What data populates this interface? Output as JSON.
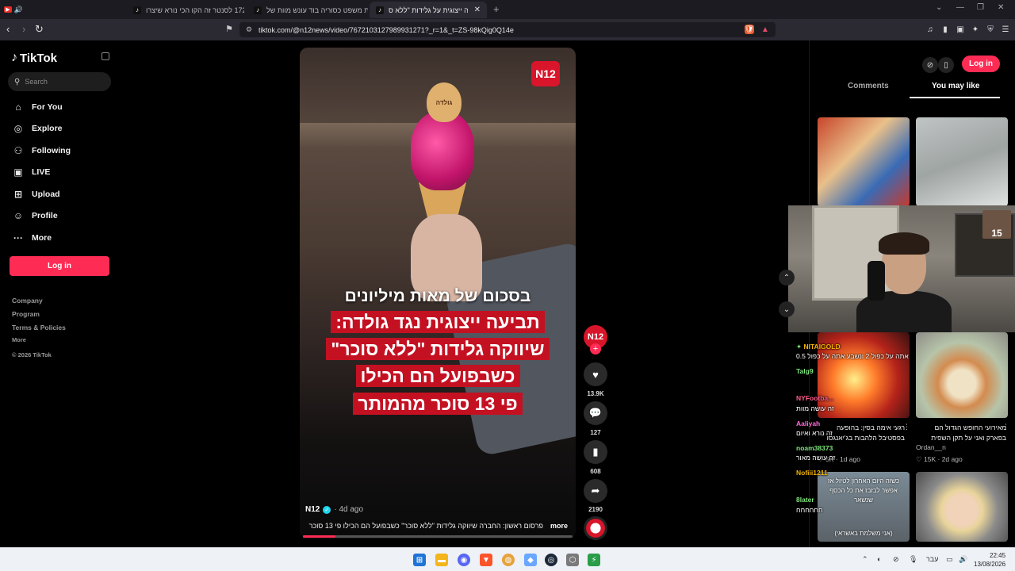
{
  "browser": {
    "tabs": [
      {
        "title": "קו 172 לסנטר זה הקו הכי נורא שיצרו",
        "active": false
      },
      {
        "title": "בית משפט כסוריה בוד עונש מוות של...",
        "active": false
      },
      {
        "title": "תביעה ייצוגית על גלידות \"ללא ס...",
        "active": true
      }
    ],
    "new_tab": "+",
    "url": "tiktok.com/@n12news/video/7672103127989931271?_r=1&_t=ZS-98kQig0Q14e"
  },
  "sidebar": {
    "logo": "TikTok",
    "search_placeholder": "Search",
    "menu": [
      {
        "label": "For You",
        "icon": "home-icon"
      },
      {
        "label": "Explore",
        "icon": "compass-icon"
      },
      {
        "label": "Following",
        "icon": "following-icon"
      },
      {
        "label": "LIVE",
        "icon": "live-icon"
      },
      {
        "label": "Upload",
        "icon": "upload-icon"
      },
      {
        "label": "Profile",
        "icon": "profile-icon"
      },
      {
        "label": "More",
        "icon": "more-icon"
      }
    ],
    "login": "Log in",
    "footer": [
      "Company",
      "Program",
      "Terms & Policies",
      "More"
    ],
    "copyright": "© 2026 TikTok"
  },
  "video": {
    "badge": "N12",
    "cookie_text": "גולדה",
    "headline_top": "בסכום של מאות מיליונים",
    "headline_lines": [
      "תביעה ייצוגית נגד גולדה:",
      "שיווקה גלידות \"ללא סוכר\"",
      "כשבפועל הם הכילו",
      "פי 13 סוכר מהמותר"
    ],
    "author": "N12",
    "posted": "· 4d ago",
    "caption": "פרסום ראשון: החברה שיווקה גלידות \"ללא סוכר\" כשבפועל הם הכילו פי 13 סוכר",
    "more": "more",
    "progress": 0.12
  },
  "actions": {
    "avatar": "N12",
    "likes": "13.9K",
    "comments": "127",
    "saves": "608",
    "shares": "2190"
  },
  "right_panel": {
    "login": "Log in",
    "tabs": [
      "Comments",
      "You may like"
    ],
    "active_tab": "You may like",
    "cards": [
      {
        "title": "רגעי אימה בסין: בהופעה בפסטיבל הלהבות בג'יאנגסו",
        "author": "",
        "likes": "5K",
        "age": "1d ago"
      },
      {
        "title": "מאירועי החופש הגדול הם בפארק ואני על תקן השפית",
        "author": "Ordan__n",
        "likes": "15K",
        "age": "2d ago"
      }
    ],
    "card_text_1": "כשזה היום האחרון לטיול אז אפשר לבזבז את כל הכסף שנשאר",
    "card_text_2": "(אני משלמת באשראי)"
  },
  "stream_overlay": {
    "webcam_badge": "15",
    "chat": [
      {
        "user": "NITAIGOLD",
        "color": "#f4b400",
        "msg": "אתה על כפול 2 ונשבע אתה על כפול 0.5"
      },
      {
        "user": "Talg9",
        "color": "#7ee67e",
        "msg": ""
      },
      {
        "user": "NYFootba...",
        "color": "#ff5c8a",
        "msg": "זה עושה מוות"
      },
      {
        "user": "Aaliyah",
        "color": "#ff6bd6",
        "msg": "זה נורא ואיום"
      },
      {
        "user": "noam38373",
        "color": "#7ee67e",
        "msg": "זה עושה מאור"
      },
      {
        "user": "Nofiii1211",
        "color": "#f4b400",
        "msg": ""
      },
      {
        "user": "8later",
        "color": "#7ee67e",
        "msg": "חחחחחח"
      }
    ]
  },
  "taskbar": {
    "lang": "עבר",
    "time": "22:45",
    "date": "13/08/2026"
  }
}
